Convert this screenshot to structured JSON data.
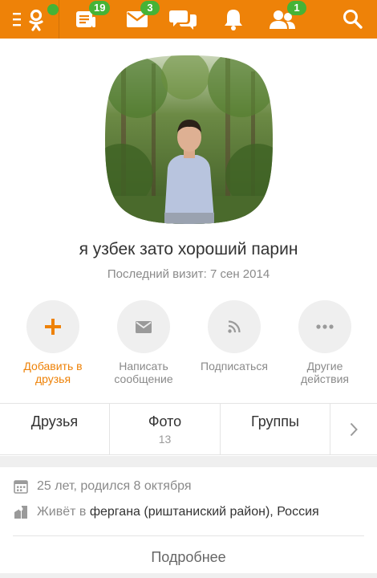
{
  "topbar": {
    "color": "#ee8208",
    "badge_color": "#46b336",
    "items": [
      {
        "icon": "menu-ok-logo-icon",
        "badge": ""
      },
      {
        "icon": "feed-icon",
        "badge": "19"
      },
      {
        "icon": "mail-icon",
        "badge": "3"
      },
      {
        "icon": "chat-icon",
        "badge": ""
      },
      {
        "icon": "bell-icon",
        "badge": ""
      },
      {
        "icon": "friends-icon",
        "badge": "1"
      },
      {
        "icon": "search-icon",
        "badge": ""
      }
    ]
  },
  "profile": {
    "name": "я узбек зато хороший парин",
    "last_visit": "Последний визит: 7 сен 2014"
  },
  "actions": [
    {
      "label": "Добавить в друзья",
      "icon": "plus-icon",
      "accent": "#ee8208"
    },
    {
      "label": "Написать сообщение",
      "icon": "envelope-icon"
    },
    {
      "label": "Подписаться",
      "icon": "rss-icon"
    },
    {
      "label": "Другие действия",
      "icon": "more-dots-icon"
    }
  ],
  "tabs": [
    {
      "label": "Друзья",
      "count": ""
    },
    {
      "label": "Фото",
      "count": "13"
    },
    {
      "label": "Группы",
      "count": ""
    }
  ],
  "info": {
    "age": "25 лет, родился 8 октября",
    "lives_prefix": "Живёт в",
    "lives_place": "фергана (риштаниский район), Россия"
  },
  "more_label": "Подробнее"
}
